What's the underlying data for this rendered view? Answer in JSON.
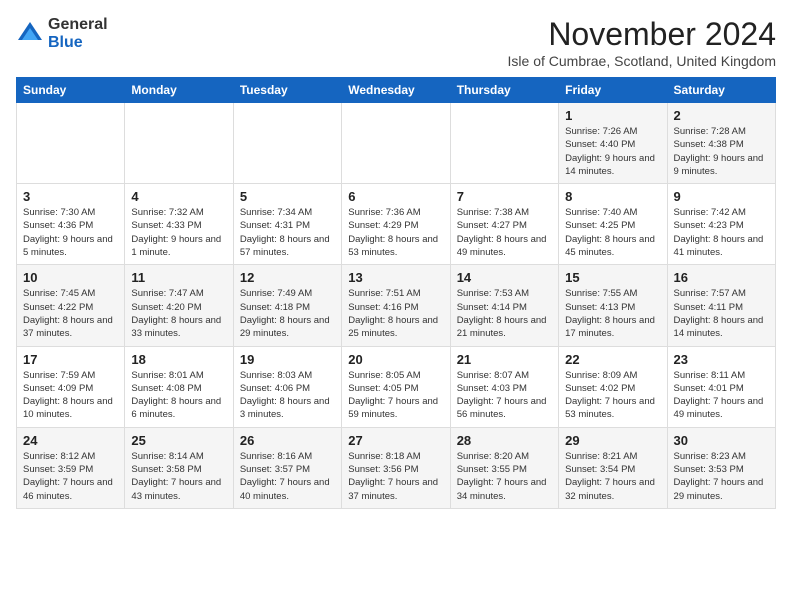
{
  "logo": {
    "general": "General",
    "blue": "Blue"
  },
  "title": "November 2024",
  "subtitle": "Isle of Cumbrae, Scotland, United Kingdom",
  "headers": [
    "Sunday",
    "Monday",
    "Tuesday",
    "Wednesday",
    "Thursday",
    "Friday",
    "Saturday"
  ],
  "weeks": [
    [
      {
        "day": "",
        "info": ""
      },
      {
        "day": "",
        "info": ""
      },
      {
        "day": "",
        "info": ""
      },
      {
        "day": "",
        "info": ""
      },
      {
        "day": "",
        "info": ""
      },
      {
        "day": "1",
        "info": "Sunrise: 7:26 AM\nSunset: 4:40 PM\nDaylight: 9 hours and 14 minutes."
      },
      {
        "day": "2",
        "info": "Sunrise: 7:28 AM\nSunset: 4:38 PM\nDaylight: 9 hours and 9 minutes."
      }
    ],
    [
      {
        "day": "3",
        "info": "Sunrise: 7:30 AM\nSunset: 4:36 PM\nDaylight: 9 hours and 5 minutes."
      },
      {
        "day": "4",
        "info": "Sunrise: 7:32 AM\nSunset: 4:33 PM\nDaylight: 9 hours and 1 minute."
      },
      {
        "day": "5",
        "info": "Sunrise: 7:34 AM\nSunset: 4:31 PM\nDaylight: 8 hours and 57 minutes."
      },
      {
        "day": "6",
        "info": "Sunrise: 7:36 AM\nSunset: 4:29 PM\nDaylight: 8 hours and 53 minutes."
      },
      {
        "day": "7",
        "info": "Sunrise: 7:38 AM\nSunset: 4:27 PM\nDaylight: 8 hours and 49 minutes."
      },
      {
        "day": "8",
        "info": "Sunrise: 7:40 AM\nSunset: 4:25 PM\nDaylight: 8 hours and 45 minutes."
      },
      {
        "day": "9",
        "info": "Sunrise: 7:42 AM\nSunset: 4:23 PM\nDaylight: 8 hours and 41 minutes."
      }
    ],
    [
      {
        "day": "10",
        "info": "Sunrise: 7:45 AM\nSunset: 4:22 PM\nDaylight: 8 hours and 37 minutes."
      },
      {
        "day": "11",
        "info": "Sunrise: 7:47 AM\nSunset: 4:20 PM\nDaylight: 8 hours and 33 minutes."
      },
      {
        "day": "12",
        "info": "Sunrise: 7:49 AM\nSunset: 4:18 PM\nDaylight: 8 hours and 29 minutes."
      },
      {
        "day": "13",
        "info": "Sunrise: 7:51 AM\nSunset: 4:16 PM\nDaylight: 8 hours and 25 minutes."
      },
      {
        "day": "14",
        "info": "Sunrise: 7:53 AM\nSunset: 4:14 PM\nDaylight: 8 hours and 21 minutes."
      },
      {
        "day": "15",
        "info": "Sunrise: 7:55 AM\nSunset: 4:13 PM\nDaylight: 8 hours and 17 minutes."
      },
      {
        "day": "16",
        "info": "Sunrise: 7:57 AM\nSunset: 4:11 PM\nDaylight: 8 hours and 14 minutes."
      }
    ],
    [
      {
        "day": "17",
        "info": "Sunrise: 7:59 AM\nSunset: 4:09 PM\nDaylight: 8 hours and 10 minutes."
      },
      {
        "day": "18",
        "info": "Sunrise: 8:01 AM\nSunset: 4:08 PM\nDaylight: 8 hours and 6 minutes."
      },
      {
        "day": "19",
        "info": "Sunrise: 8:03 AM\nSunset: 4:06 PM\nDaylight: 8 hours and 3 minutes."
      },
      {
        "day": "20",
        "info": "Sunrise: 8:05 AM\nSunset: 4:05 PM\nDaylight: 7 hours and 59 minutes."
      },
      {
        "day": "21",
        "info": "Sunrise: 8:07 AM\nSunset: 4:03 PM\nDaylight: 7 hours and 56 minutes."
      },
      {
        "day": "22",
        "info": "Sunrise: 8:09 AM\nSunset: 4:02 PM\nDaylight: 7 hours and 53 minutes."
      },
      {
        "day": "23",
        "info": "Sunrise: 8:11 AM\nSunset: 4:01 PM\nDaylight: 7 hours and 49 minutes."
      }
    ],
    [
      {
        "day": "24",
        "info": "Sunrise: 8:12 AM\nSunset: 3:59 PM\nDaylight: 7 hours and 46 minutes."
      },
      {
        "day": "25",
        "info": "Sunrise: 8:14 AM\nSunset: 3:58 PM\nDaylight: 7 hours and 43 minutes."
      },
      {
        "day": "26",
        "info": "Sunrise: 8:16 AM\nSunset: 3:57 PM\nDaylight: 7 hours and 40 minutes."
      },
      {
        "day": "27",
        "info": "Sunrise: 8:18 AM\nSunset: 3:56 PM\nDaylight: 7 hours and 37 minutes."
      },
      {
        "day": "28",
        "info": "Sunrise: 8:20 AM\nSunset: 3:55 PM\nDaylight: 7 hours and 34 minutes."
      },
      {
        "day": "29",
        "info": "Sunrise: 8:21 AM\nSunset: 3:54 PM\nDaylight: 7 hours and 32 minutes."
      },
      {
        "day": "30",
        "info": "Sunrise: 8:23 AM\nSunset: 3:53 PM\nDaylight: 7 hours and 29 minutes."
      }
    ]
  ]
}
